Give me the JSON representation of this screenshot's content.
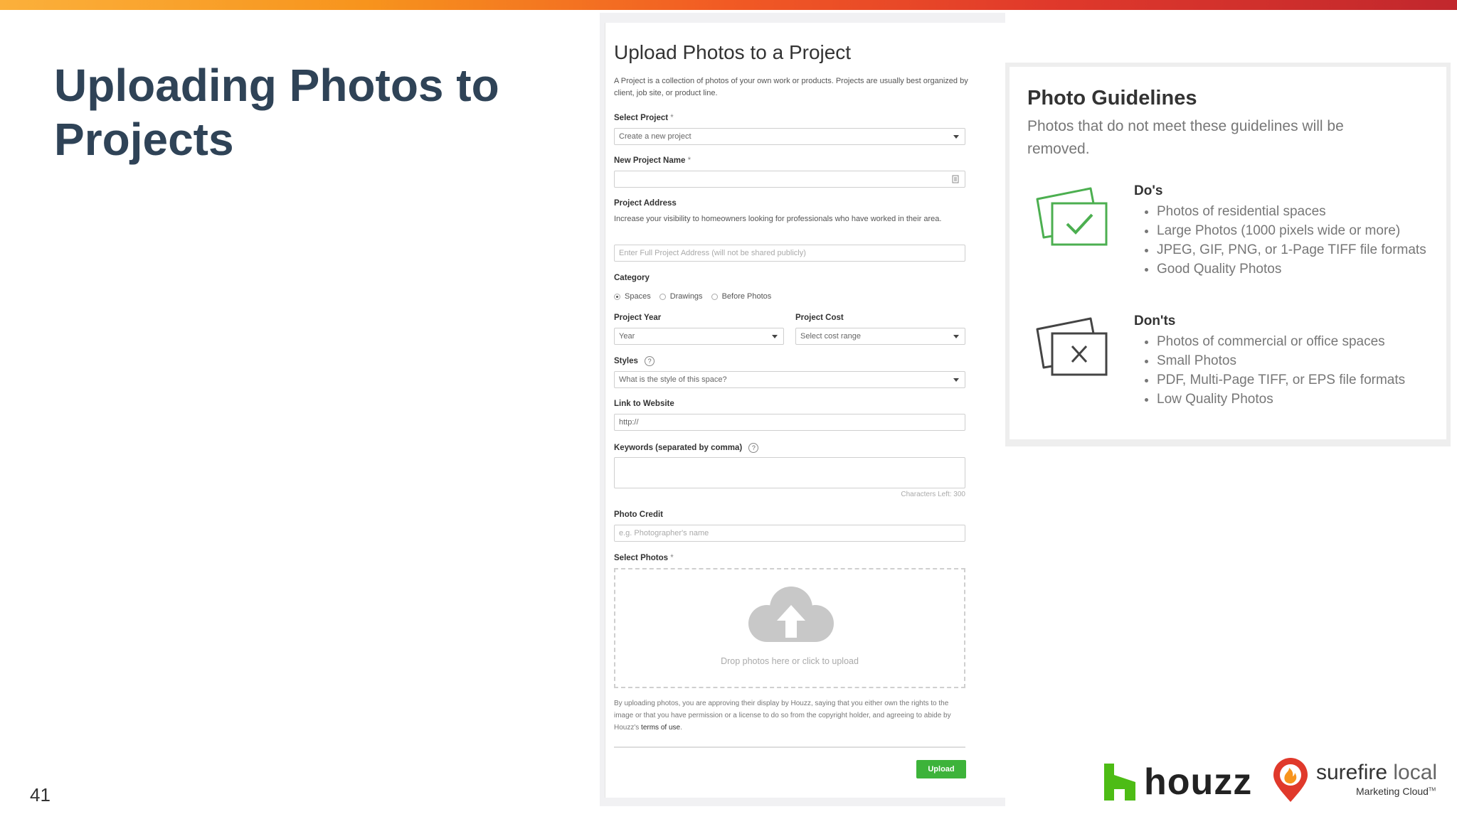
{
  "slide": {
    "title": "Uploading Photos to Projects",
    "number": "41"
  },
  "form": {
    "title": "Upload Photos to a Project",
    "description": "A Project is a collection of photos of your own work or products. Projects are usually best organized by client, job site, or product line.",
    "select_project": {
      "label": "Select Project",
      "required_mark": "*",
      "value": "Create a new project"
    },
    "new_project_name": {
      "label": "New Project Name",
      "required_mark": "*",
      "value": ""
    },
    "project_address": {
      "label": "Project Address",
      "help": "Increase your visibility to homeowners looking for professionals who have worked in their area.",
      "placeholder": "Enter Full Project Address (will not be shared publicly)"
    },
    "category": {
      "label": "Category",
      "options": [
        "Spaces",
        "Drawings",
        "Before Photos"
      ],
      "selected": "Spaces"
    },
    "project_year": {
      "label": "Project Year",
      "value": "Year"
    },
    "project_cost": {
      "label": "Project Cost",
      "value": "Select cost range"
    },
    "styles": {
      "label": "Styles",
      "help_icon": "?",
      "value": "What is the style of this space?"
    },
    "website": {
      "label": "Link to Website",
      "value": "http://"
    },
    "keywords": {
      "label": "Keywords (separated by comma)",
      "help_icon": "?",
      "chars_left": "Characters Left: 300"
    },
    "photo_credit": {
      "label": "Photo Credit",
      "placeholder": "e.g. Photographer's name"
    },
    "select_photos": {
      "label": "Select Photos",
      "required_mark": "*",
      "drop_text": "Drop photos here or click to upload"
    },
    "legal_text": "By uploading photos, you are approving their display by Houzz, saying that you either own the rights to the image or that you have permission or a license to do so from the copyright holder, and agreeing to abide by Houzz's",
    "terms_link": "terms of use",
    "legal_end": ".",
    "upload_button": "Upload"
  },
  "guidelines": {
    "title": "Photo Guidelines",
    "subtitle": "Photos that do not meet these guidelines will be removed.",
    "dos_title": "Do's",
    "dos": [
      "Photos of residential spaces",
      "Large Photos (1000 pixels wide or more)",
      "JPEG, GIF, PNG, or 1-Page TIFF file formats",
      "Good Quality Photos"
    ],
    "donts_title": "Don'ts",
    "donts": [
      "Photos of commercial or office spaces",
      "Small Photos",
      "PDF, Multi-Page TIFF, or EPS file formats",
      "Low Quality Photos"
    ]
  },
  "logos": {
    "houzz": "houzz",
    "surefire_bold": "surefire",
    "surefire_light": "local",
    "surefire_tag": "Marketing Cloud",
    "surefire_tm": "TM"
  },
  "colors": {
    "title": "#2f4357",
    "upload_green": "#3db33a",
    "do_green": "#4caf50",
    "houzz_green": "#4dbc15",
    "surefire_red": "#e0392b"
  }
}
